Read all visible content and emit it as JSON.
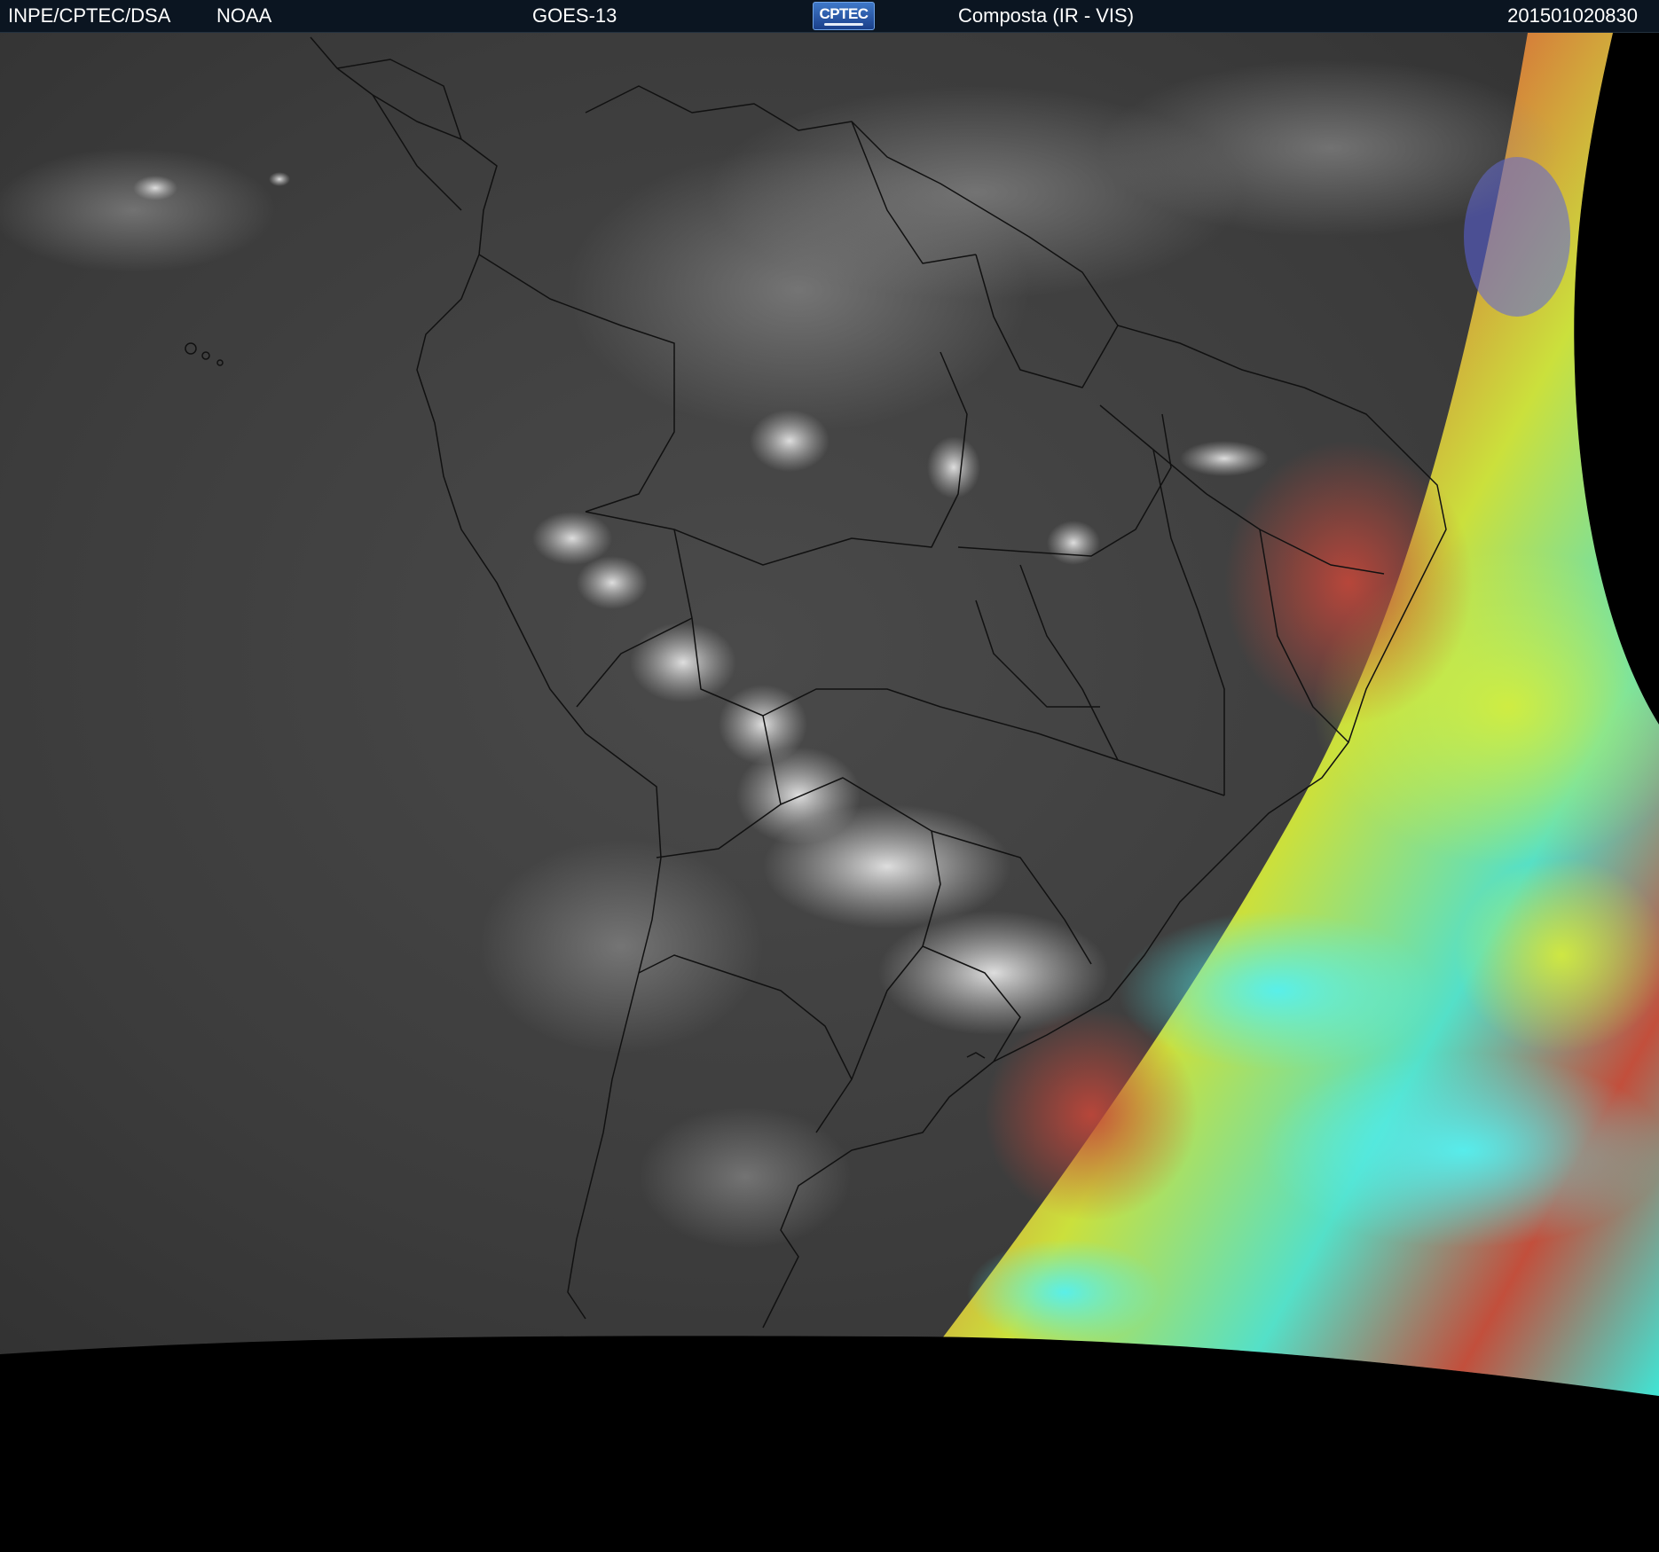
{
  "header": {
    "agency": "INPE/CPTEC/DSA",
    "source": "NOAA",
    "satellite": "GOES-13",
    "logo_text": "CPTEC",
    "product": "Composta (IR - VIS)",
    "timestamp": "201501020830"
  },
  "colors": {
    "header_bg": "#0b1521",
    "space_black": "#000000",
    "night_ir_gray": "#3a3a3a",
    "day_composite_red": "#c8523a",
    "day_composite_yellow": "#c9e23a",
    "day_composite_cyan": "#3ee6d8"
  }
}
